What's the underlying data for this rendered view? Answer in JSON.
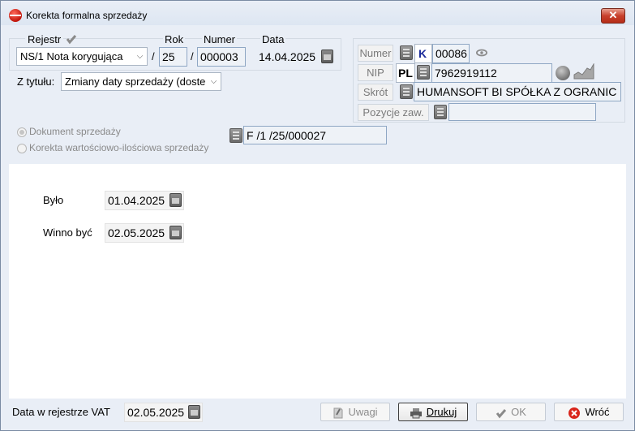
{
  "window": {
    "title": "Korekta formalna sprzedaży",
    "close_label": "✕"
  },
  "header": {
    "rejestr_label": "Rejestr",
    "rejestr_value": "NS/1 Nota korygująca",
    "separator1": "/",
    "rok_label": "Rok",
    "rok_value": "25",
    "separator2": "/",
    "numer_label": "Numer",
    "numer_value": "000003",
    "data_label": "Data",
    "data_value": "14.04.2025",
    "z_tytulu_label": "Z tytułu:",
    "z_tytulu_value": "Zmiany daty sprzedaży (doste"
  },
  "contractor": {
    "numer_button": "Numer",
    "numer_prefix": "K",
    "numer_value": "00086",
    "nip_button": "NIP",
    "nip_prefix": "PL",
    "nip_value": "7962919112",
    "skrot_button": "Skrót",
    "skrot_value": "HUMANSOFT BI SPÓŁKA Z OGRANIC",
    "pozycje_button": "Pozycje zaw.",
    "pozycje_value": ""
  },
  "document_type": {
    "option1": "Dokument sprzedaży",
    "option2": "Korekta wartościowo-ilościowa sprzedaży",
    "doc_number": "F /1  /25/000027"
  },
  "dates": {
    "bylo_label": "Było",
    "bylo_value": "01.04.2025",
    "winno_label": "Winno być",
    "winno_value": "02.05.2025"
  },
  "footer": {
    "vat_label": "Data w rejestrze VAT",
    "vat_value": "02.05.2025",
    "uwagi": "Uwagi",
    "drukuj": "Drukuj",
    "ok": "OK",
    "wroc": "Wróć"
  }
}
